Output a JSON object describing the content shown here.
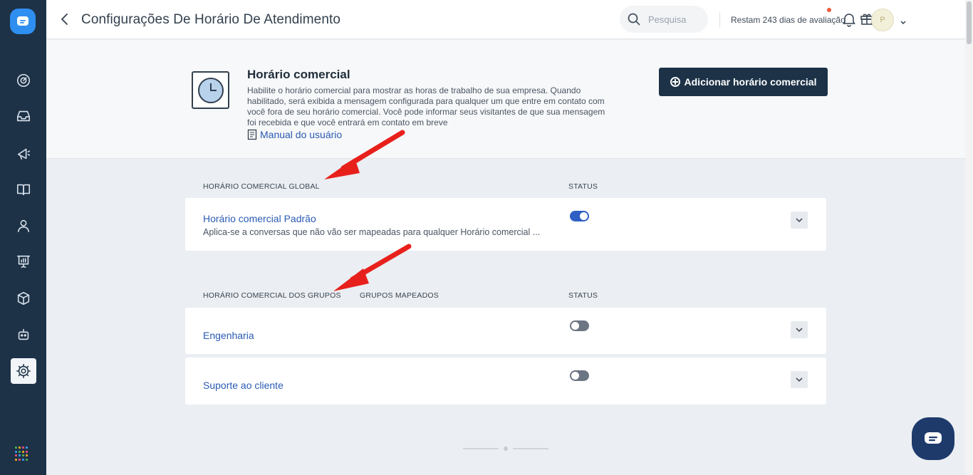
{
  "topbar": {
    "title": "Configurações De Horário De Atendimento",
    "search_placeholder": "Pesquisa",
    "trial_text": "Restam 243 dias de avaliação",
    "avatar_initial": "P"
  },
  "header": {
    "title": "Horário comercial",
    "description": "Habilite o horário comercial para mostrar as horas de trabalho de sua empresa. Quando habilitado, será exibida a mensagem configurada para qualquer um que entre em contato com você fora de seu horário comercial. Você pode informar seus visitantes de que sua mensagem foi recebida e que você entrará em contato em breve",
    "manual_link": "Manual do usuário",
    "add_button": "Adicionar horário comercial"
  },
  "global_section": {
    "col_name": "HORÁRIO COMERCIAL GLOBAL",
    "col_status": "STATUS",
    "rows": [
      {
        "name": "Horário comercial Padrão",
        "subtitle": "Aplica-se a conversas que não vão ser mapeadas para qualquer Horário comercial ...",
        "enabled": true
      }
    ]
  },
  "groups_section": {
    "col_name": "HORÁRIO COMERCIAL DOS GRUPOS",
    "col_groups": "GRUPOS MAPEADOS",
    "col_status": "STATUS",
    "rows": [
      {
        "name": "Engenharia",
        "enabled": false
      },
      {
        "name": "Suporte ao cliente",
        "enabled": false
      }
    ]
  },
  "colors": {
    "sidebar": "#1d3247",
    "accent": "#2d5fc4",
    "link": "#2a5bb3",
    "annotation_arrow": "#e8201c"
  },
  "sidebar_icons": [
    "dashboard-icon",
    "inbox-icon",
    "megaphone-icon",
    "book-icon",
    "contacts-icon",
    "reports-icon",
    "cube-icon",
    "bot-icon",
    "settings-icon",
    "apps-grid-icon"
  ]
}
